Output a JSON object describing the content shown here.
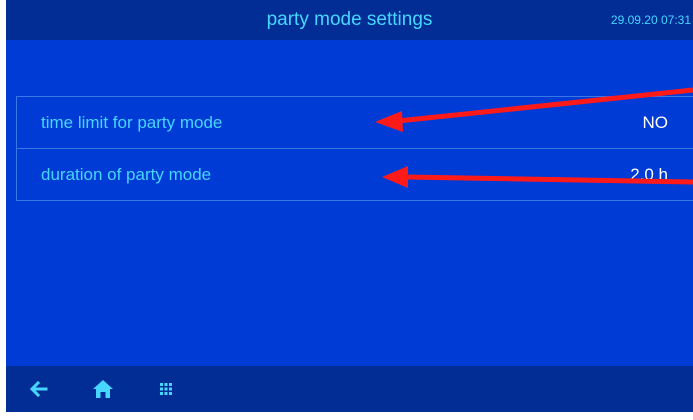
{
  "header": {
    "title": "party mode settings",
    "datetime": "29.09.20 07:31"
  },
  "settings": [
    {
      "label": "time limit for party mode",
      "value": "NO"
    },
    {
      "label": "duration of party mode",
      "value": "2,0 h"
    }
  ],
  "footer": {
    "icons": [
      "back-arrow-icon",
      "home-icon",
      "menu-grid-icon"
    ]
  },
  "colors": {
    "background": "#003bd6",
    "bar": "#022d95",
    "accent_text": "#47d6ff",
    "value_text": "#ffffff",
    "annotation_arrow": "#ff0000"
  }
}
